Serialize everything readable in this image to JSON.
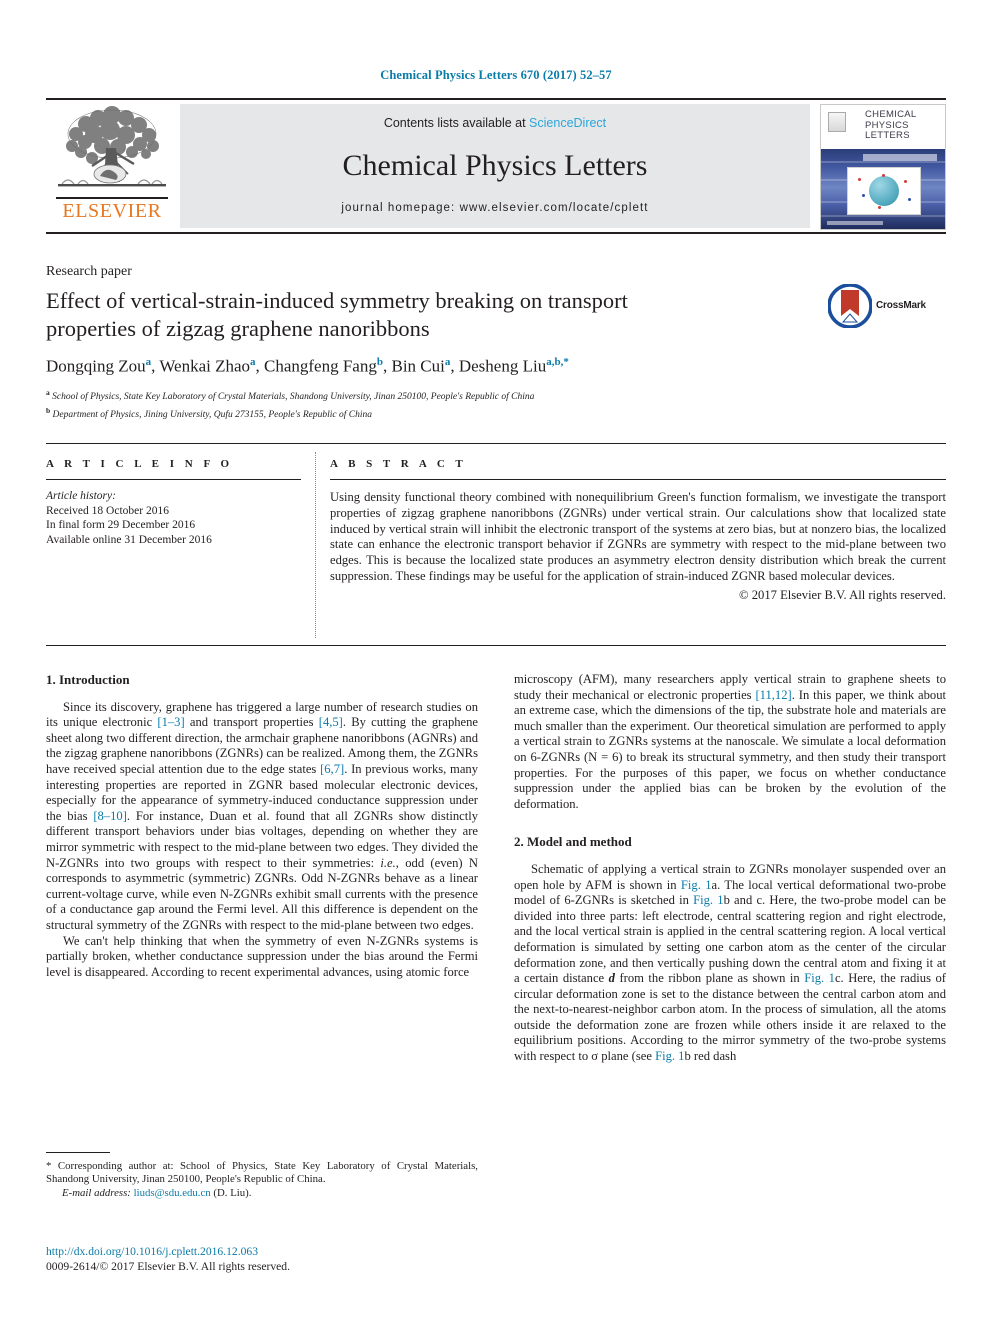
{
  "running_head": "Chemical Physics Letters 670 (2017) 52–57",
  "masthead": {
    "contents_prefix": "Contents lists available at ",
    "sciencedirect": "ScienceDirect",
    "journal_name": "Chemical Physics Letters",
    "journal_homepage": "journal homepage: www.elsevier.com/locate/cplett",
    "publisher": "ELSEVIER",
    "cover": {
      "line1": "CHEMICAL",
      "line2": "PHYSICS",
      "line3": "LETTERS"
    }
  },
  "article": {
    "type": "Research paper",
    "title": "Effect of vertical-strain-induced symmetry breaking on transport properties of zigzag graphene nanoribbons",
    "crossmark_label": "CrossMark",
    "authors_html": "Dongqing Zou<sup>a</sup>, Wenkai Zhao<sup>a</sup>, Changfeng Fang<sup>b</sup>, Bin Cui<sup>a</sup>, Desheng Liu<sup>a,b,*</sup>",
    "affiliation_a": "School of Physics, State Key Laboratory of Crystal Materials, Shandong University, Jinan 250100, People's Republic of China",
    "affiliation_b": "Department of Physics, Jining University, Qufu 273155, People's Republic of China"
  },
  "article_info": {
    "heading": "A R T I C L E   I N F O",
    "history_label": "Article history:",
    "received": "Received 18 October 2016",
    "final_form": "In final form 29 December 2016",
    "available_online": "Available online 31 December 2016"
  },
  "abstract": {
    "heading": "A B S T R A C T",
    "text": "Using density functional theory combined with nonequilibrium Green's function formalism, we investigate the transport properties of zigzag graphene nanoribbons (ZGNRs) under vertical strain. Our calculations show that localized state induced by vertical strain will inhibit the electronic transport of the systems at zero bias, but at nonzero bias, the localized state can enhance the electronic transport behavior if ZGNRs are symmetry with respect to the mid-plane between two edges. This is because the localized state produces an asymmetry electron density distribution which break the current suppression. These findings may be useful for the application of strain-induced ZGNR based molecular devices.",
    "copyright": "© 2017 Elsevier B.V. All rights reserved."
  },
  "sections": {
    "introduction_heading": "1. Introduction",
    "intro_p1_part1": "Since its discovery, graphene has triggered a large number of research studies on its unique electronic ",
    "intro_p1_ref1": "[1–3]",
    "intro_p1_part2": " and transport properties ",
    "intro_p1_ref2": "[4,5]",
    "intro_p1_part3": ". By cutting the graphene sheet along two different direction, the armchair graphene nanoribbons (AGNRs) and the zigzag graphene nanoribbons (ZGNRs) can be realized. Among them, the ZGNRs have received special attention due to the edge states ",
    "intro_p1_ref3": "[6,7]",
    "intro_p1_part4": ". In previous works, many interesting properties are reported in ZGNR based molecular electronic devices, especially for the appearance of symmetry-induced conductance suppression under the bias ",
    "intro_p1_ref4": "[8–10]",
    "intro_p1_part5": ". For instance, Duan et al. found that all ZGNRs show distinctly different transport behaviors under bias voltages, depending on whether they are mirror symmetric with respect to the mid-plane between two edges. They divided the N-ZGNRs into two groups with respect to their symmetries: ",
    "intro_p1_italic": "i.e.",
    "intro_p1_part6": ", odd (even) N corresponds to asymmetric (symmetric) ZGNRs. Odd N-ZGNRs behave as a linear current-voltage curve, while even N-ZGNRs exhibit small currents with the presence of a conductance gap around the Fermi level. All this difference is dependent on the structural symmetry of the ZGNRs with respect to the mid-plane between two edges.",
    "intro_p2": "We can't help thinking that when the symmetry of even N-ZGNRs systems is partially broken, whether conductance suppression under the bias around the Fermi level is disappeared. According to recent experimental advances, using atomic force",
    "right_p1_part1": "microscopy (AFM), many researchers apply vertical strain to graphene sheets to study their mechanical or electronic properties ",
    "right_p1_ref1": "[11,12]",
    "right_p1_part2": ". In this paper, we think about an extreme case, which the dimensions of the tip, the substrate hole and materials are much smaller than the experiment. Our theoretical simulation are performed to apply a vertical strain to ZGNRs systems at the nanoscale. We simulate a local deformation on 6-ZGNRs (N = 6) to break its structural symmetry, and then study their transport properties. For the purposes of this paper, we focus on whether conductance suppression under the applied bias can be broken by the evolution of the deformation.",
    "model_heading": "2. Model and method",
    "model_p1_part1": "Schematic of applying a vertical strain to ZGNRs monolayer suspended over an open hole by AFM is shown in ",
    "model_p1_ref1": "Fig. 1",
    "model_p1_part2": "a. The local vertical deformational two-probe model of 6-ZGNRs is sketched in ",
    "model_p1_ref2": "Fig. 1",
    "model_p1_part3": "b and c. Here, the two-probe model can be divided into three parts: left electrode, central scattering region and right electrode, and the local vertical strain is applied in the central scattering region. A local vertical deformation is simulated by setting one carbon atom as the center of the circular deformation zone, and then vertically pushing down the central atom and fixing it at a certain distance ",
    "model_p1_bold": "d",
    "model_p1_part4": " from the ribbon plane as shown in ",
    "model_p1_ref3": "Fig. 1",
    "model_p1_part5": "c. Here, the radius of circular deformation zone is set to the distance between the central carbon atom and the next-to-nearest-neighbor carbon atom. In the process of simulation, all the atoms outside the deformation zone are frozen while others inside it are relaxed to the equilibrium positions. According to the mirror symmetry of the two-probe systems with respect to σ plane (see ",
    "model_p1_ref4": "Fig. 1",
    "model_p1_part6": "b red dash"
  },
  "footnote": {
    "marker": "*",
    "text": " Corresponding author at: School of Physics, State Key Laboratory of Crystal Materials, Shandong University, Jinan 250100, People's Republic of China.",
    "email_label": "E-mail address:",
    "email": "liuds@sdu.edu.cn",
    "email_suffix": " (D. Liu)."
  },
  "bottom": {
    "doi": "http://dx.doi.org/10.1016/j.cplett.2016.12.063",
    "issn_line": "0009-2614/© 2017 Elsevier B.V. All rights reserved."
  },
  "colors": {
    "link": "#0b7ba8",
    "sciencedirect": "#2ba6d9",
    "elsevier_orange": "#e87722",
    "band_gray": "#e6e7e8"
  }
}
